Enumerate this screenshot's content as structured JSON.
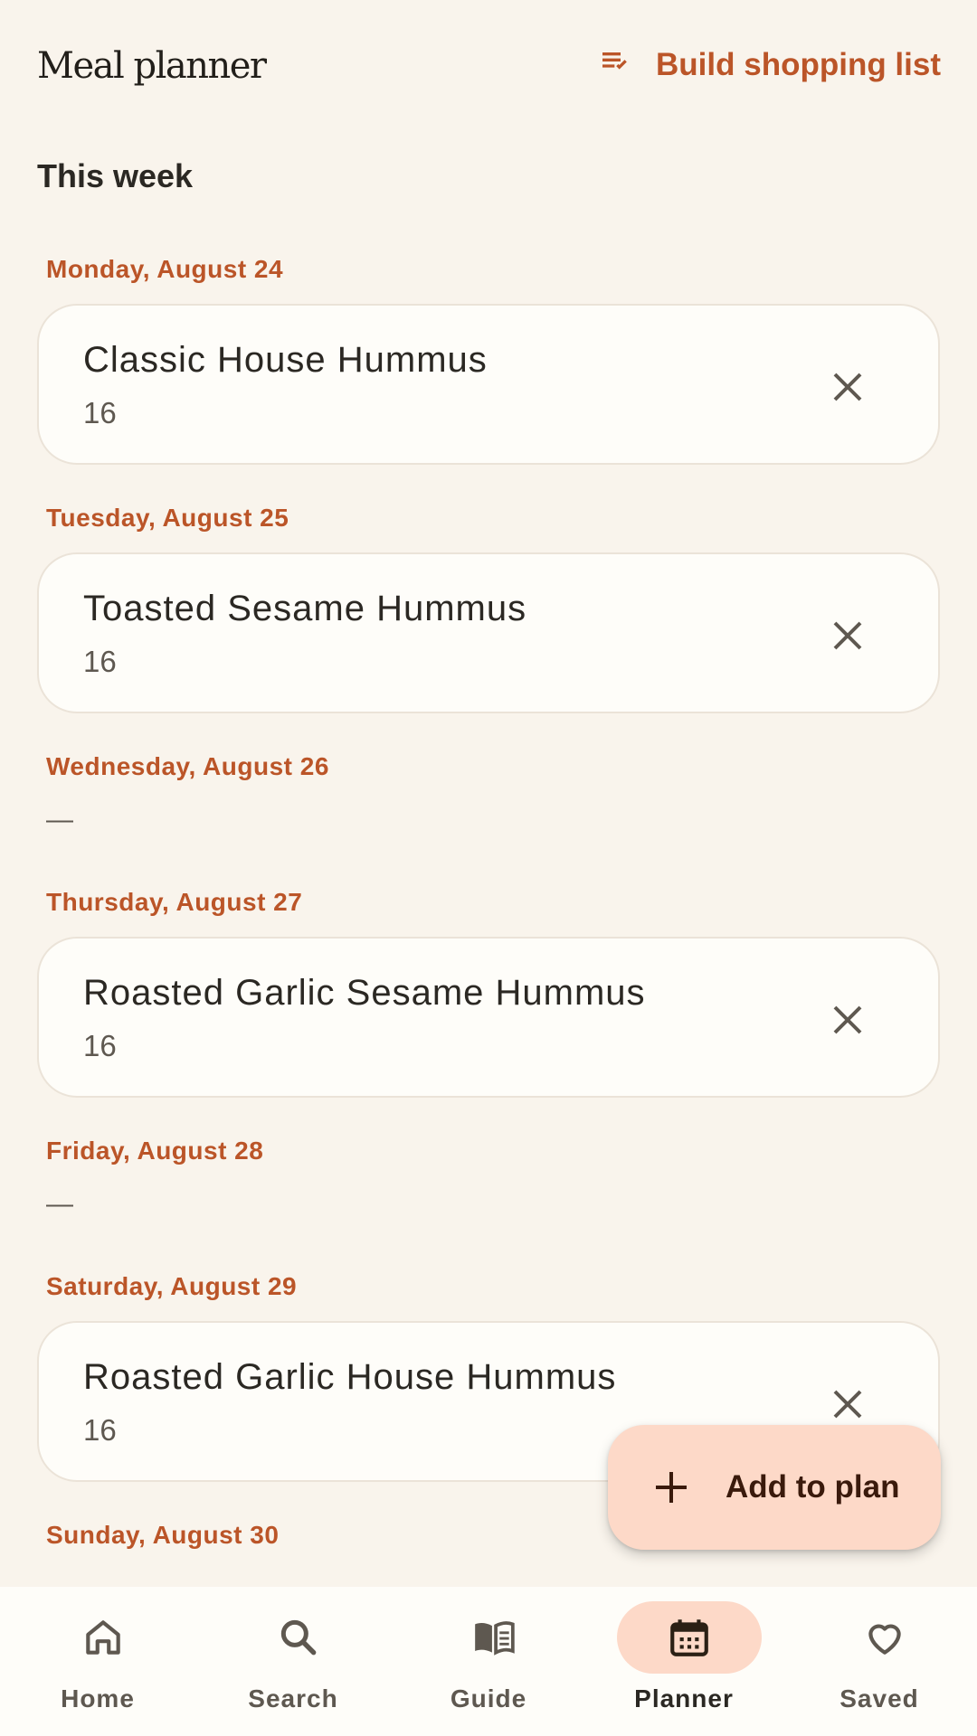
{
  "header": {
    "title": "Meal planner",
    "shopping_button": "Build shopping list"
  },
  "section_title": "This week",
  "days": [
    {
      "label": "Monday, August 24",
      "meal": {
        "name": "Classic House Hummus",
        "sub": "16"
      }
    },
    {
      "label": "Tuesday, August 25",
      "meal": {
        "name": "Toasted Sesame Hummus",
        "sub": "16"
      }
    },
    {
      "label": "Wednesday, August 26",
      "empty": "—"
    },
    {
      "label": "Thursday, August 27",
      "meal": {
        "name": "Roasted Garlic Sesame Hummus",
        "sub": "16"
      }
    },
    {
      "label": "Friday, August 28",
      "empty": "—"
    },
    {
      "label": "Saturday, August 29",
      "meal": {
        "name": "Roasted Garlic House Hummus",
        "sub": "16"
      }
    },
    {
      "label": "Sunday, August 30"
    }
  ],
  "fab": {
    "label": "Add to plan"
  },
  "nav": [
    {
      "label": "Home",
      "icon": "home-icon",
      "active": false
    },
    {
      "label": "Search",
      "icon": "search-icon",
      "active": false
    },
    {
      "label": "Guide",
      "icon": "book-icon",
      "active": false
    },
    {
      "label": "Planner",
      "icon": "calendar-icon",
      "active": true
    },
    {
      "label": "Saved",
      "icon": "heart-icon",
      "active": false
    }
  ],
  "colors": {
    "accent": "#bb5528",
    "background": "#f9f4ec",
    "card": "#fefdf9",
    "active_pill": "#fdd9c8"
  }
}
